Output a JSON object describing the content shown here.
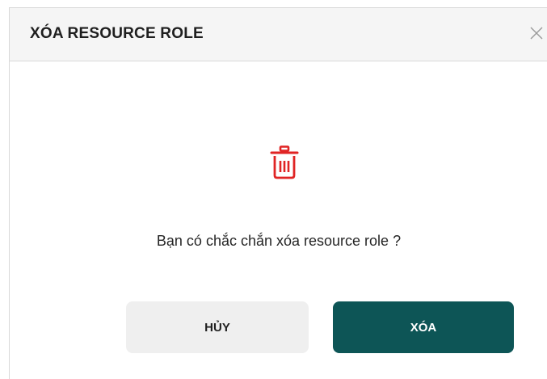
{
  "dialog": {
    "title": "XÓA RESOURCE ROLE",
    "close_icon": "close-icon",
    "icon": "trash-icon",
    "icon_color": "#e02424",
    "message": "Bạn có chắc chắn xóa resource role ?",
    "cancel_label": "HỦY",
    "delete_label": "XÓA",
    "delete_button_color": "#0d5556"
  }
}
